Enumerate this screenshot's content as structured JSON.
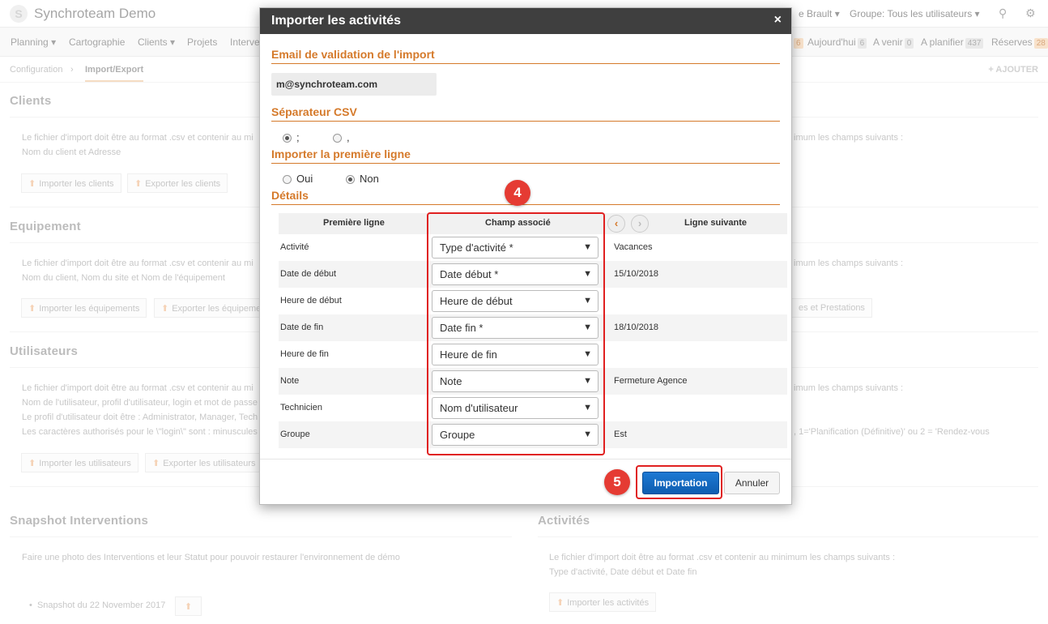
{
  "app": {
    "name": "Synchroteam Demo",
    "logo_letter": "S",
    "user_label": "e Brault",
    "group_label": "Groupe: Tous les utilisateurs",
    "caret": "▾"
  },
  "nav": {
    "items": [
      "Planning",
      "Cartographie",
      "Clients",
      "Projets",
      "Interve"
    ],
    "today_label": "Aujourd'hui",
    "today_count": "6",
    "upcoming_label": "A venir",
    "upcoming_count": "0",
    "to_plan_label": "A planifier",
    "to_plan_count": "437",
    "reserves_label": "Réserves",
    "reserves_count": "28",
    "left_count": "6"
  },
  "breadcrumb": {
    "items": [
      "Configuration",
      "Import/Export"
    ],
    "add_label": "+ AJOUTER"
  },
  "background": {
    "clients_title": "Clients",
    "clients_text1": "Le fichier d'import doit être au format .csv et contenir au mi",
    "clients_text2": "Nom du client et Adresse",
    "clients_right": "imum les champs suivants :",
    "import_clients": "Importer les clients",
    "export_clients": "Exporter les clients",
    "equip_title": "Equipement",
    "equip_text1": "Le fichier d'import doit être au format .csv et contenir au mi",
    "equip_text2": "Nom du client, Nom du site et Nom de l'équipement",
    "equip_right": "imum les champs suivants :",
    "import_equip": "Importer les équipements",
    "export_equip": "Exporter les équipeme",
    "prestations": "es et Prestations",
    "users_title": "Utilisateurs",
    "users_text1": "Le fichier d'import doit être au format .csv et contenir au mi",
    "users_text2": "Nom de l'utilisateur, profil d'utilisateur, login et mot de passe",
    "users_text3": "Le profil d'utilisateur doit être : Administrator, Manager, Tech",
    "users_text4": "Les caractères authorisés pour le \\\"login\\\" sont : minuscules",
    "users_right1": "imum les champs suivants :",
    "users_right2": ", 1='Planification (Définitive)' ou 2 = 'Rendez-vous",
    "import_users": "Importer les utilisateurs",
    "export_users": "Exporter les utilisateurs",
    "snapshot_title": "Snapshot Interventions",
    "snapshot_text": "Faire une photo des Interventions et leur Statut pour pouvoir restaurer l'environnement de démo",
    "snapshot_item": "Snapshot du 22 November 2017",
    "activities_title": "Activités",
    "activities_text1": "Le fichier d'import doit être au format .csv et contenir au minimum les champs suivants :",
    "activities_text2": "Type d'activité, Date début et Date fin",
    "import_activities": "Importer les activités"
  },
  "modal": {
    "title": "Importer les activités",
    "close": "×",
    "email_section": "Email de validation de l'import",
    "email_value": "m@synchroteam.com",
    "csv_section": "Séparateur CSV",
    "csv_options": [
      ";",
      ","
    ],
    "first_line_section": "Importer la première ligne",
    "first_line_options": [
      "Oui",
      "Non"
    ],
    "details_section": "Détails",
    "col_first": "Première ligne",
    "col_field": "Champ associé",
    "col_next": "Ligne suivante",
    "prev_arrow": "‹",
    "next_arrow": "›",
    "rows": [
      {
        "label": "Activité",
        "field": "Type d'activité *",
        "next": "Vacances"
      },
      {
        "label": "Date de début",
        "field": "Date début *",
        "next": "15/10/2018"
      },
      {
        "label": "Heure de début",
        "field": "Heure de début",
        "next": ""
      },
      {
        "label": "Date de fin",
        "field": "Date fin *",
        "next": "18/10/2018"
      },
      {
        "label": "Heure de fin",
        "field": "Heure de fin",
        "next": ""
      },
      {
        "label": "Note",
        "field": "Note",
        "next": "Fermeture Agence"
      },
      {
        "label": "Technicien",
        "field": "Nom d'utilisateur",
        "next": ""
      },
      {
        "label": "Groupe",
        "field": "Groupe",
        "next": "Est"
      }
    ],
    "select_arrow": "▼",
    "import_button": "Importation",
    "cancel_button": "Annuler",
    "step4": "4",
    "step5": "5"
  }
}
